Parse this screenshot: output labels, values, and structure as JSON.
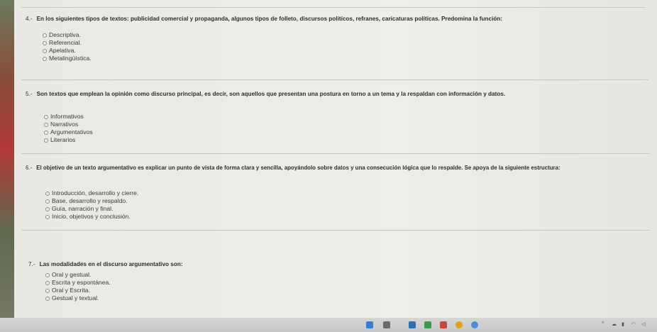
{
  "questions": [
    {
      "number": "4.-",
      "text": "En los siguientes tipos de textos: publicidad comercial y propaganda, algunos tipos de folleto, discursos políticos, refranes, caricaturas políticas. Predomina la función:",
      "options": [
        "Descriptiva.",
        "Referencial.",
        "Apelativa.",
        "Metalingüística."
      ]
    },
    {
      "number": "5.-",
      "text": "Son textos que emplean la opinión como discurso principal, es decir, son aquellos que presentan una postura en torno a un tema y la respaldan con información y datos.",
      "options": [
        "Informativos",
        "Narrativos",
        "Argumentativos",
        "Literarios"
      ]
    },
    {
      "number": "6.-",
      "text": "El objetivo de un texto argumentativo es explicar un punto de vista de forma clara y sencilla, apoyándolo sobre datos y una consecución lógica que lo respalde. Se apoya de la siguiente estructura:",
      "options": [
        "Introducción, desarrollo y cierre.",
        "Base, desarrollo y respaldo.",
        "Guía, narración y final.",
        "Inicio, objetivos y conclusión."
      ]
    },
    {
      "number": "7.-",
      "text": "Las modalidades en el discurso argumentativo son:",
      "options": [
        "Oral y gestual.",
        "Escrita y espontánea.",
        "Oral y Escrita.",
        "Gestual y textual."
      ]
    }
  ],
  "colors": {
    "page": "#eceae6",
    "divider": "#c9c7c3",
    "text": "#2e2e2e"
  }
}
